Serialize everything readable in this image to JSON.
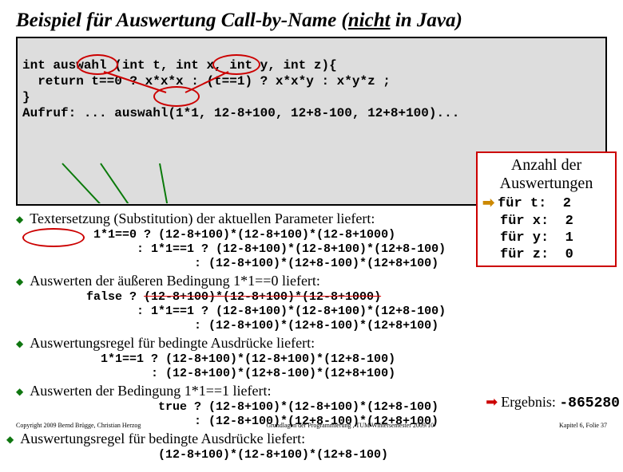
{
  "title_pre": "Beispiel für Auswertung Call-by-Name (",
  "title_not": "nicht",
  "title_post": " in Java)",
  "code": {
    "l1": "int auswahl (int t, int x, int y, int z){",
    "l2": "  return t==0 ? x*x*x : (t==1) ? x*x*y : x*y*z ;",
    "l3": "}",
    "l4": "Aufruf: ... auswahl(1*1, 12-8+100, 12+8-100, 12+8+100)..."
  },
  "b": {
    "b1": "Textersetzung (Substitution) der aktuellen Parameter liefert:",
    "c1": "   1*1==0 ? (12-8+100)*(12-8+100)*(12-8+1000)\n         : 1*1==1 ? (12-8+100)*(12-8+100)*(12+8-100)\n                 : (12-8+100)*(12+8-100)*(12+8+100)",
    "b2": "Auswerten der äußeren Bedingung 1*1==0 liefert:",
    "c2a": "  false ? ",
    "c2s": "(12-8+100)*(12-8+100)*(12-8+1000)",
    "c2b": "         : 1*1==1 ? (12-8+100)*(12-8+100)*(12+8-100)\n                 : (12-8+100)*(12+8-100)*(12+8+100)",
    "b3": "Auswertungsregel für bedingte Ausdrücke liefert:",
    "c3": "    1*1==1 ? (12-8+100)*(12-8+100)*(12+8-100)\n           : (12-8+100)*(12+8-100)*(12+8+100)",
    "b4": "Auswerten der Bedingung 1*1==1 liefert:",
    "c4": "  true ? (12-8+100)*(12-8+100)*(12+8-100)\n       : (12-8+100)*(12+8-100)*(12+8+100)",
    "b5": "Auswertungsregel für bedingte Ausdrücke liefert:",
    "c5": "  (12-8+100)*(12-8+100)*(12+8-100)"
  },
  "side": {
    "h1": "Anzahl der",
    "h2": "Auswertungen",
    "r": [
      {
        "l": "für t:",
        "v": "2"
      },
      {
        "l": "für x:",
        "v": "2"
      },
      {
        "l": "für y:",
        "v": "1"
      },
      {
        "l": "für z:",
        "v": "0"
      }
    ]
  },
  "result": {
    "label": "Ergebnis: ",
    "val": "-865280"
  },
  "footer": {
    "l": "Copyright 2009 Bernd Brügge, Christian Herzog",
    "c": "Grundlagen der Programmierung , TUM Wintersemester 2009/10",
    "r": "Kapitel 6, Folie 37"
  }
}
